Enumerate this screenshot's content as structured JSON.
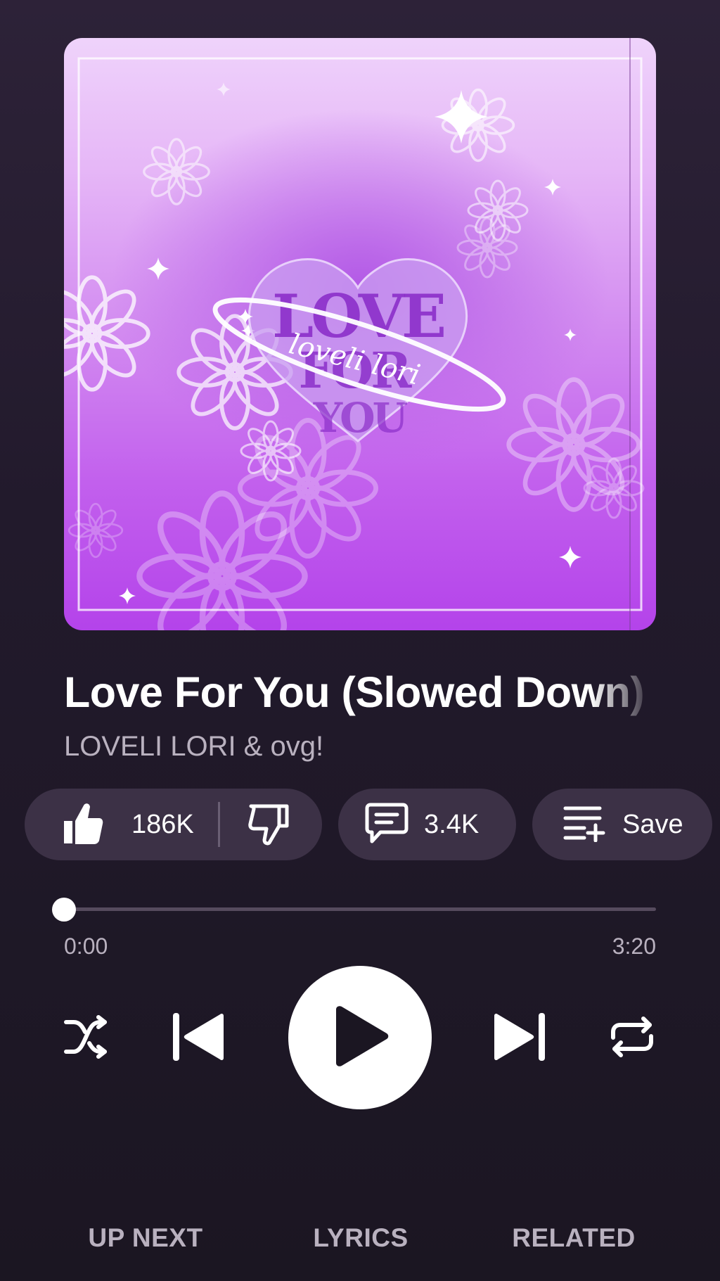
{
  "track": {
    "title": "Love For You (Slowed Down)",
    "artist": "LOVELI LORI & ovg!"
  },
  "album_art": {
    "cover_text_main": "LOVE FOR YOU",
    "cover_text_script": "loveli lori"
  },
  "actions": {
    "like_count": "186K",
    "comment_count": "3.4K",
    "save_label": "Save"
  },
  "progress": {
    "current_time": "0:00",
    "total_time": "3:20",
    "fraction": 0.0
  },
  "controls": [
    "shuffle",
    "previous",
    "play",
    "next",
    "repeat"
  ],
  "tabs": [
    {
      "label": "UP NEXT"
    },
    {
      "label": "LYRICS"
    },
    {
      "label": "RELATED"
    }
  ],
  "colors": {
    "background": "#221a2c",
    "chip": "#3c3146",
    "secondary_text": "#b9b1bf",
    "art_purple": "#c260ed"
  }
}
